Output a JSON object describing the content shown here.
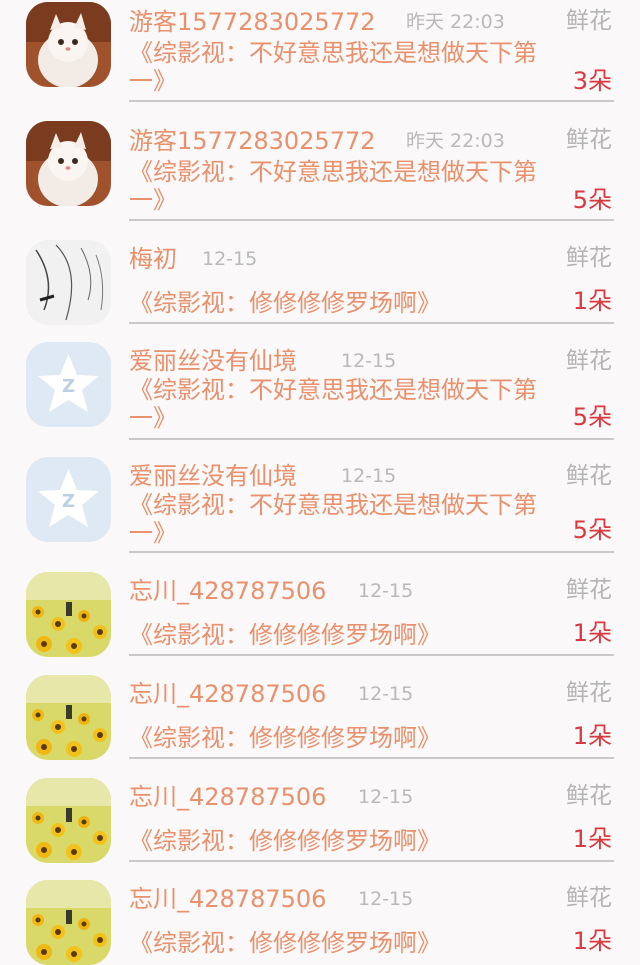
{
  "gift_label": "鲜花",
  "comments": [
    {
      "avatar": "cat-avatar-icon",
      "name": "游客1577283025772",
      "time": "昨天 22:03",
      "title": "《综影视：不好意思我还是想做天下第一》",
      "count": "3朵"
    },
    {
      "avatar": "cat-avatar-icon",
      "name": "游客1577283025772",
      "time": "昨天 22:03",
      "title": "《综影视：不好意思我还是想做天下第一》",
      "count": "5朵"
    },
    {
      "avatar": "sketch-avatar-icon",
      "name": "梅初",
      "time": "12-15",
      "title": "《综影视：修修修修罗场啊》",
      "count": "1朵"
    },
    {
      "avatar": "qq-default-avatar-icon",
      "name": "爱丽丝没有仙境",
      "time": "12-15",
      "title": "《综影视：不好意思我还是想做天下第一》",
      "count": "5朵"
    },
    {
      "avatar": "qq-default-avatar-icon",
      "name": "爱丽丝没有仙境",
      "time": "12-15",
      "title": "《综影视：不好意思我还是想做天下第一》",
      "count": "5朵"
    },
    {
      "avatar": "sunflower-avatar-icon",
      "name": "忘川_428787506",
      "time": "12-15",
      "title": "《综影视：修修修修罗场啊》",
      "count": "1朵"
    },
    {
      "avatar": "sunflower-avatar-icon",
      "name": "忘川_428787506",
      "time": "12-15",
      "title": "《综影视：修修修修罗场啊》",
      "count": "1朵"
    },
    {
      "avatar": "sunflower-avatar-icon",
      "name": "忘川_428787506",
      "time": "12-15",
      "title": "《综影视：修修修修罗场啊》",
      "count": "1朵"
    },
    {
      "avatar": "sunflower-avatar-icon",
      "name": "忘川_428787506",
      "time": "12-15",
      "title": "《综影视：修修修修罗场啊》",
      "count": "1朵"
    }
  ]
}
